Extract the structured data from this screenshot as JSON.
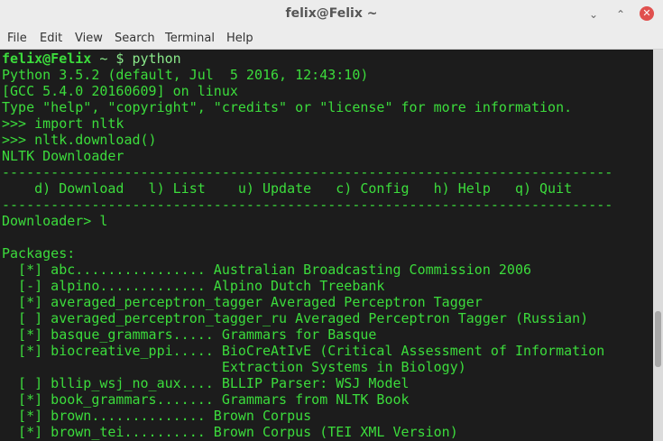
{
  "window": {
    "title": "felix@Felix ~",
    "minimize_glyph": "⌄",
    "maximize_glyph": "⌃",
    "close_glyph": "✕"
  },
  "menu": [
    "File",
    "Edit",
    "View",
    "Search",
    "Terminal",
    "Help"
  ],
  "terminal": {
    "prompt_user": "felix@Felix",
    "prompt_rest": " ~ $ python",
    "lines": [
      "Python 3.5.2 (default, Jul  5 2016, 12:43:10)",
      "[GCC 5.4.0 20160609] on linux",
      "Type \"help\", \"copyright\", \"credits\" or \"license\" for more information.",
      ">>> import nltk",
      ">>> nltk.download()",
      "NLTK Downloader",
      "---------------------------------------------------------------------------",
      "    d) Download   l) List    u) Update   c) Config   h) Help   q) Quit",
      "---------------------------------------------------------------------------",
      "Downloader> l",
      "",
      "Packages:",
      "  [*] abc................ Australian Broadcasting Commission 2006",
      "  [-] alpino............. Alpino Dutch Treebank",
      "  [*] averaged_perceptron_tagger Averaged Perceptron Tagger",
      "  [ ] averaged_perceptron_tagger_ru Averaged Perceptron Tagger (Russian)",
      "  [*] basque_grammars..... Grammars for Basque",
      "  [*] biocreative_ppi..... BioCreAtIvE (Critical Assessment of Information",
      "                           Extraction Systems in Biology)",
      "  [ ] bllip_wsj_no_aux.... BLLIP Parser: WSJ Model",
      "  [*] book_grammars....... Grammars from NLTK Book",
      "  [*] brown.............. Brown Corpus",
      "  [*] brown_tei.......... Brown Corpus (TEI XML Version)"
    ]
  }
}
